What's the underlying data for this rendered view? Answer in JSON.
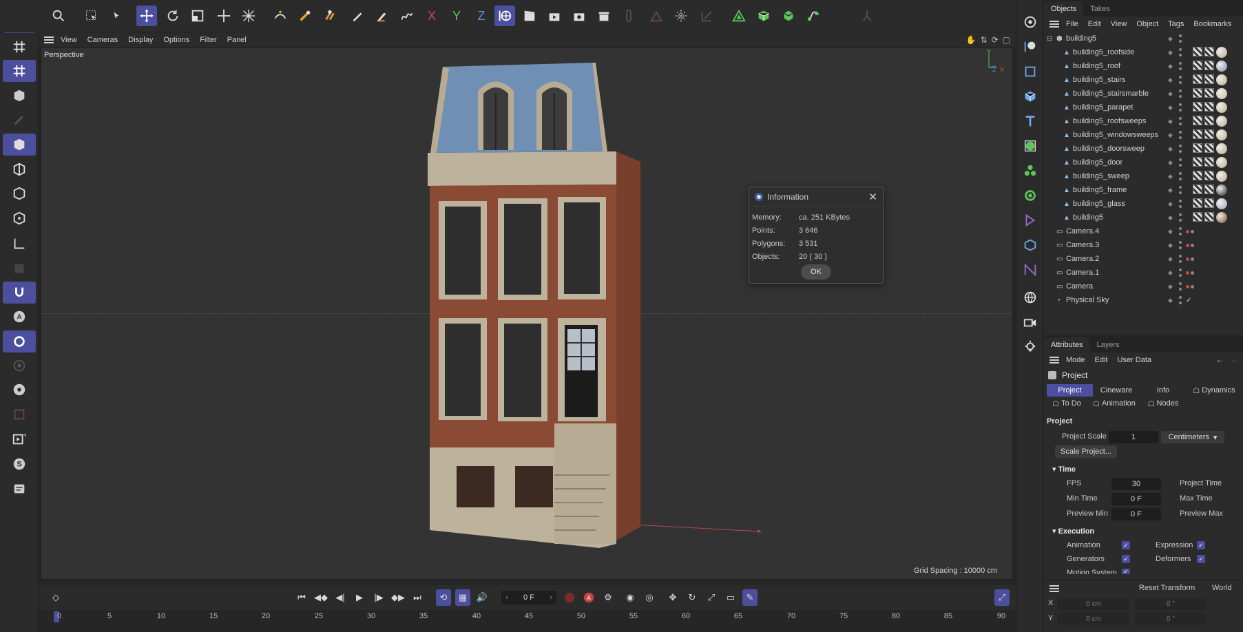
{
  "viewport": {
    "menu": [
      "View",
      "Cameras",
      "Display",
      "Options",
      "Filter",
      "Panel"
    ],
    "camera_label": "Perspective",
    "grid_spacing": "Grid Spacing : 10000 cm",
    "axis_labels": {
      "y": "Y",
      "z": "Z",
      "x": "X"
    }
  },
  "toolbar": {
    "axis_x": "X",
    "axis_y": "Y",
    "axis_z": "Z"
  },
  "dialog": {
    "title": "Information",
    "rows": [
      {
        "label": "Memory:",
        "value": "ca. 251 KBytes"
      },
      {
        "label": "Points:",
        "value": "3 646"
      },
      {
        "label": "Polygons:",
        "value": "3 531"
      },
      {
        "label": "Objects:",
        "value": "20 ( 30 )"
      }
    ],
    "ok_label": "OK"
  },
  "timeline": {
    "frame_value": "0 F",
    "ticks": [
      "0",
      "5",
      "10",
      "15",
      "20",
      "25",
      "30",
      "35",
      "40",
      "45",
      "50",
      "55",
      "60",
      "65",
      "70",
      "75",
      "80",
      "85",
      "90"
    ]
  },
  "objects_panel": {
    "tabs": [
      "Objects",
      "Takes"
    ],
    "menu": [
      "File",
      "Edit",
      "View",
      "Object",
      "Tags",
      "Bookmarks"
    ],
    "root": "building5",
    "children": [
      {
        "name": "building5_roofside",
        "material": "#b9a98c"
      },
      {
        "name": "building5_roof",
        "material": "#7c8fa8"
      },
      {
        "name": "building5_stairs",
        "material": "#b9a98c"
      },
      {
        "name": "building5_stairsmarble",
        "material": "#c4b99e"
      },
      {
        "name": "building5_parapet",
        "material": "#b9a98c"
      },
      {
        "name": "building5_roofsweeps",
        "material": "#b9a98c"
      },
      {
        "name": "building5_windowsweeps",
        "material": "#b9a98c"
      },
      {
        "name": "building5_doorsweep",
        "material": "#b9a98c"
      },
      {
        "name": "building5_door",
        "material": "#b9a98c"
      },
      {
        "name": "building5_sweep",
        "material": "#b9a98c"
      },
      {
        "name": "building5_frame",
        "material": "#2a2a2a"
      },
      {
        "name": "building5_glass",
        "material": "#9aa6b3"
      },
      {
        "name": "building5",
        "material": "#7a4a30"
      }
    ],
    "others": [
      "Camera.4",
      "Camera.3",
      "Camera.2",
      "Camera.1",
      "Camera",
      "Physical Sky"
    ]
  },
  "attributes_panel": {
    "tabs": [
      "Attributes",
      "Layers"
    ],
    "menu": [
      "Mode",
      "Edit",
      "User Data"
    ],
    "object_label": "Project",
    "sub_tabs_row1": [
      "Project",
      "Cineware",
      "Info",
      "Dynamics"
    ],
    "sub_tabs_row2": [
      "To Do",
      "Animation",
      "Nodes"
    ],
    "section_project": "Project",
    "project_scale_label": "Project Scale",
    "project_scale_value": "1",
    "project_scale_unit": "Centimeters",
    "scale_project_button": "Scale Project...",
    "section_time": "Time",
    "fps_label": "FPS",
    "fps_value": "30",
    "project_time_label": "Project Time",
    "min_time_label": "Min Time",
    "min_time_value": "0 F",
    "max_time_label": "Max Time",
    "preview_min_label": "Preview Min",
    "preview_min_value": "0 F",
    "preview_max_label": "Preview Max",
    "section_execution": "Execution",
    "animation_label": "Animation",
    "expression_label": "Expression",
    "generators_label": "Generators",
    "deformers_label": "Deformers",
    "motion_system_label": "Motion System",
    "reset_transform": "Reset Transform",
    "world": "World",
    "coord_x_label": "X",
    "coord_y_label": "Y",
    "coord_x_value": "0 cm",
    "coord_y_value": "0 cm",
    "coord_x_rot": "0 °",
    "coord_y_rot": "0 °"
  }
}
